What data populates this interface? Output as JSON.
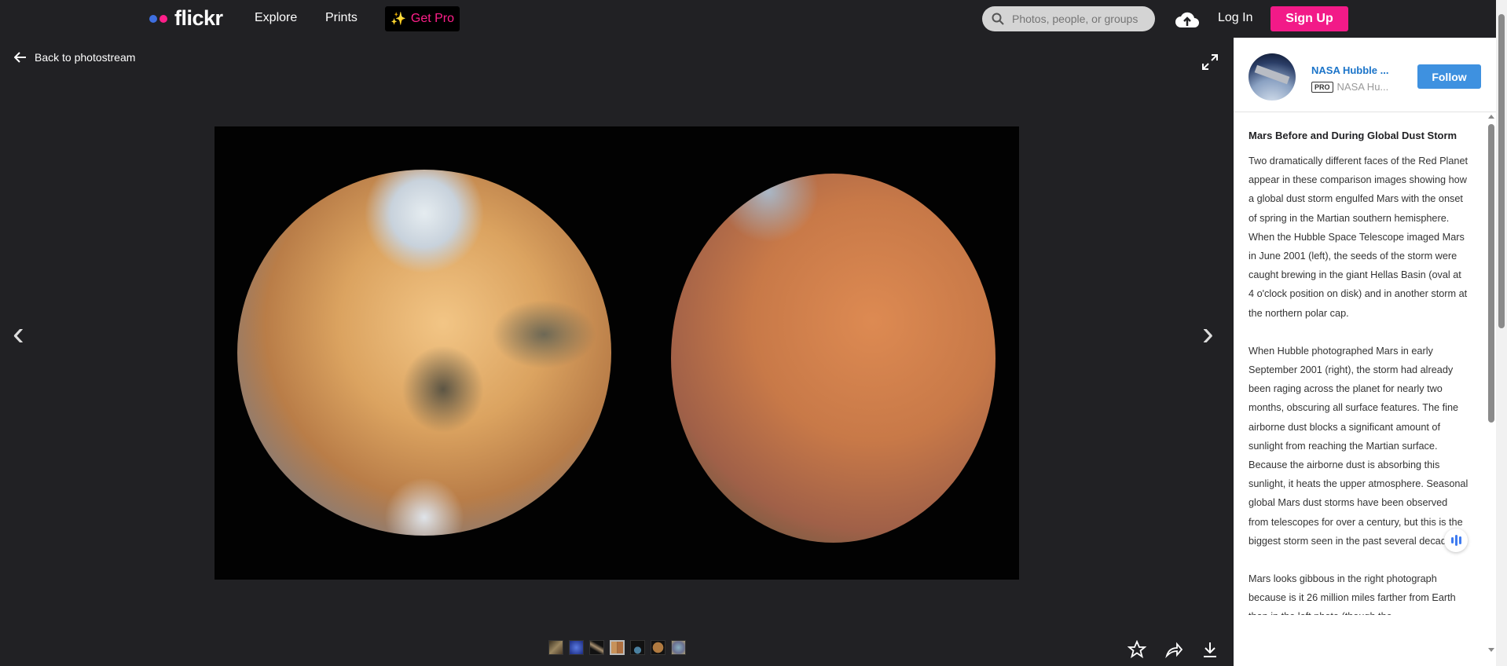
{
  "header": {
    "logo": "flickr",
    "nav": [
      "Explore",
      "Prints"
    ],
    "get_pro": "Get Pro",
    "search_placeholder": "Photos, people, or groups",
    "login": "Log In",
    "signup": "Sign Up",
    "colors": {
      "blue": "#3e6fe0",
      "pink": "#ff1f8a"
    }
  },
  "viewer": {
    "back": "Back to photostream",
    "thumbnail_count": 7,
    "selected_thumbnail": 4
  },
  "owner": {
    "name": "NASA Hubble ...",
    "badge": "PRO",
    "username": "NASA Hu...",
    "follow": "Follow"
  },
  "photo": {
    "title": "Mars Before and During Global Dust Storm",
    "paragraphs": [
      "Two dramatically different faces of the Red Planet appear in these comparison images showing how a global dust storm engulfed Mars with the onset of spring in the Martian southern hemisphere. When the Hubble Space Telescope imaged Mars in June 2001 (left), the seeds of the storm were caught brewing in the giant Hellas Basin (oval at 4 o'clock position on disk) and in another storm at the northern polar cap.",
      "When Hubble photographed Mars in early September 2001 (right), the storm had already been raging across the planet for nearly two months, obscuring all surface features. The fine airborne dust blocks a significant amount of sunlight from reaching the Martian surface. Because the airborne dust is absorbing this sunlight, it heats the upper atmosphere. Seasonal global Mars dust storms have been observed from telescopes for over a century, but this is the biggest storm seen in the past several decades.",
      "Mars looks gibbous in the right photograph because is it 26 million miles farther from Earth than in the left photo (though the"
    ]
  }
}
